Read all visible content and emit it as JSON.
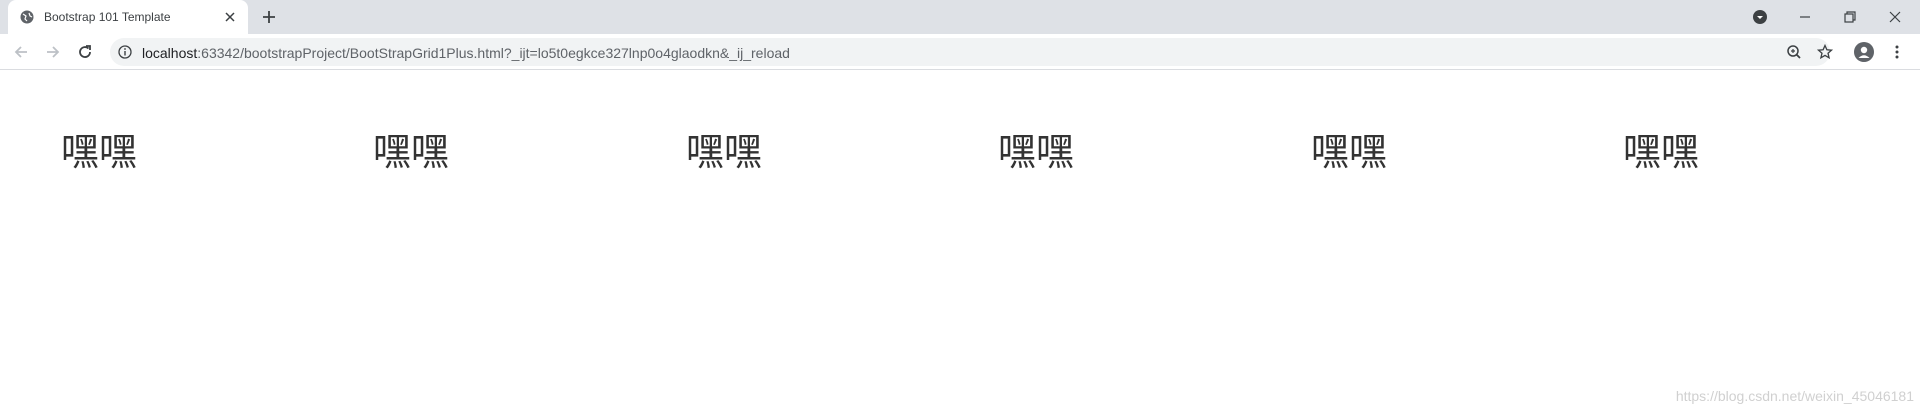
{
  "browser": {
    "tab": {
      "title": "Bootstrap 101 Template"
    },
    "address_bar": {
      "host": "localhost",
      "path": ":63342/bootstrapProject/BootStrapGrid1Plus.html?_ijt=lo5t0egkce327lnp0o4glaodkn&_ij_reload"
    }
  },
  "page": {
    "columns": [
      "嘿嘿",
      "嘿嘿",
      "嘿嘿",
      "嘿嘿",
      "嘿嘿",
      "嘿嘿"
    ],
    "watermark": "https://blog.csdn.net/weixin_45046181"
  },
  "icons": {
    "favicon": "globe-icon",
    "tab_close": "close-icon",
    "new_tab": "plus-icon",
    "profile_menu": "chevron-down-circle-icon",
    "minimize": "minimize-icon",
    "restore": "restore-icon",
    "close_window": "close-icon",
    "back": "arrow-left-icon",
    "forward": "arrow-right-icon",
    "reload": "reload-icon",
    "site_info": "info-icon",
    "zoom": "zoom-icon",
    "bookmark": "star-icon",
    "avatar": "person-icon",
    "menu": "more-vert-icon"
  }
}
